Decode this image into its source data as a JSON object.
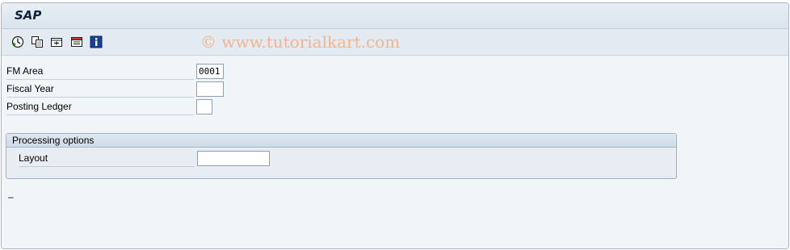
{
  "window": {
    "title": "SAP"
  },
  "toolbar": {
    "buttons": [
      {
        "icon": "execute-icon",
        "tooltip": "Execute"
      },
      {
        "icon": "copy-icon",
        "tooltip": "Copy"
      },
      {
        "icon": "selection-options-icon",
        "tooltip": "Selection options"
      },
      {
        "icon": "variant-icon",
        "tooltip": "Get variant"
      },
      {
        "icon": "info-icon",
        "tooltip": "Information"
      }
    ]
  },
  "watermark": "© www.tutorialkart.com",
  "form": {
    "fm_area": {
      "label": "FM Area",
      "value": "0001"
    },
    "fiscal_year": {
      "label": "Fiscal Year",
      "value": ""
    },
    "posting_ledger": {
      "label": "Posting Ledger",
      "value": ""
    }
  },
  "processing_options": {
    "title": "Processing options",
    "layout": {
      "label": "Layout",
      "value": ""
    }
  },
  "status": {
    "text": "–"
  },
  "colors": {
    "accent": "#12243c",
    "watermark": "#f1b590",
    "frame": "#a9b8c8"
  }
}
